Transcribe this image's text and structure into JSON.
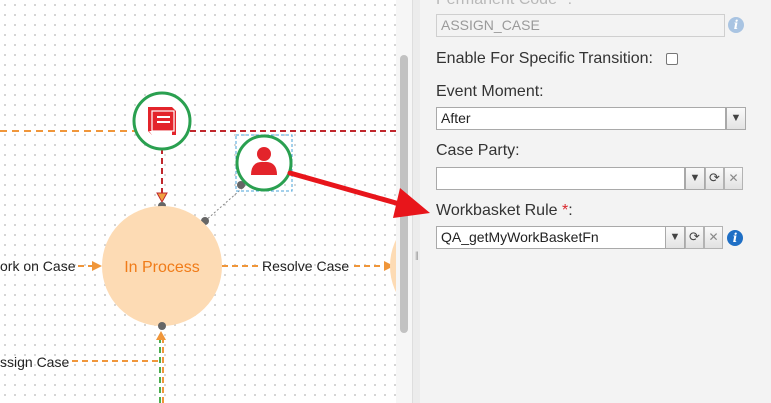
{
  "diagram": {
    "nodes": {
      "in_process": "In Process"
    },
    "transitions": {
      "work_on_case": "ork on Case",
      "resolve_case": "Resolve Case",
      "assign_case": "ssign Case"
    },
    "colors": {
      "state_fill": "#fddbb4",
      "state_text": "#f07b18",
      "event_border": "#2aa050",
      "event_icon": "#e3242b",
      "flow_line": "#f0963a",
      "dependency_line": "#c0272d",
      "annotation_arrow": "#e8151b"
    },
    "icons": {
      "book_event": "book-icon",
      "party_event": "user-icon"
    }
  },
  "properties_panel": {
    "permanent_code": {
      "label": "Permanent Code *:",
      "value": "ASSIGN_CASE"
    },
    "enable_specific_transition": {
      "label": "Enable For Specific Transition:",
      "checked": false
    },
    "event_moment": {
      "label": "Event Moment:",
      "value": "After"
    },
    "case_party": {
      "label": "Case Party:",
      "value": ""
    },
    "workbasket_rule": {
      "label": "Workbasket Rule ",
      "required_mark": "*",
      "suffix": ":",
      "value": "QA_getMyWorkBasketFn"
    },
    "glyphs": {
      "dropdown": "▼",
      "refresh": "⟳",
      "clear": "✕",
      "info": "i"
    }
  }
}
